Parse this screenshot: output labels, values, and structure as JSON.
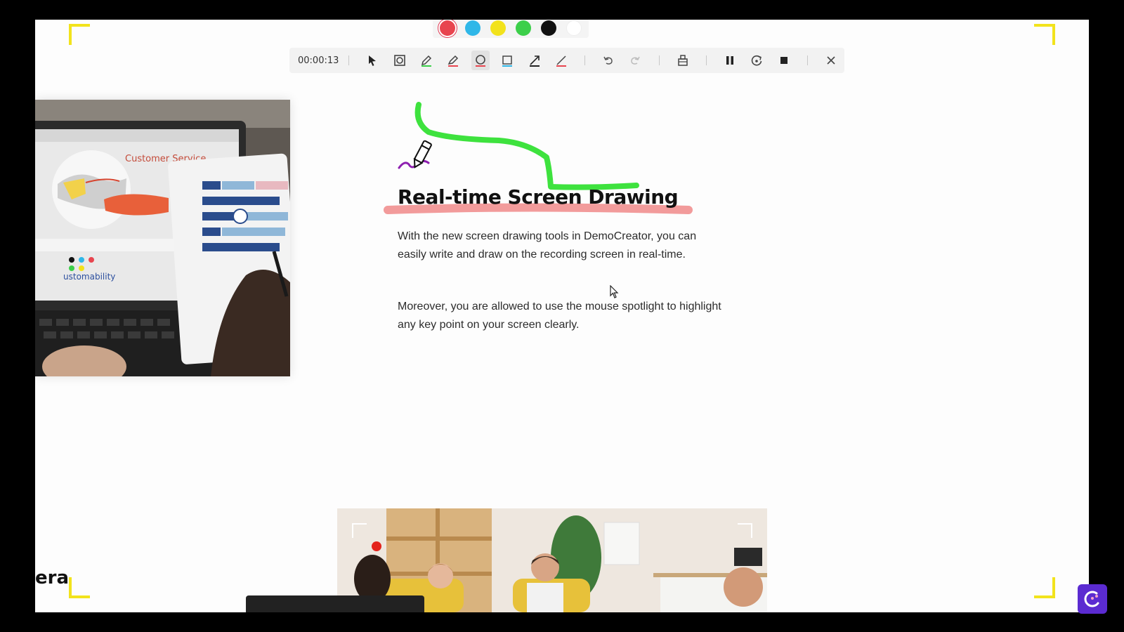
{
  "recorder": {
    "timer": "00:00:13",
    "palette": [
      {
        "name": "red",
        "color": "#e8454f",
        "selected": true
      },
      {
        "name": "blue",
        "color": "#2fb7e8",
        "selected": false
      },
      {
        "name": "yellow",
        "color": "#f2e21c",
        "selected": false
      },
      {
        "name": "green",
        "color": "#3ccf4a",
        "selected": false
      },
      {
        "name": "black",
        "color": "#111111",
        "selected": false
      },
      {
        "name": "white",
        "color": "#ffffff",
        "selected": false
      }
    ],
    "tools": [
      {
        "name": "pointer",
        "icon": "cursor-icon"
      },
      {
        "name": "spotlight",
        "icon": "spotlight-icon"
      },
      {
        "name": "pen-green",
        "icon": "pen-icon"
      },
      {
        "name": "highlighter",
        "icon": "highlighter-icon"
      },
      {
        "name": "circle",
        "icon": "circle-icon",
        "active": true
      },
      {
        "name": "rectangle",
        "icon": "rectangle-icon"
      },
      {
        "name": "arrow",
        "icon": "arrow-icon"
      },
      {
        "name": "line",
        "icon": "line-icon"
      },
      {
        "name": "undo",
        "icon": "undo-icon"
      },
      {
        "name": "redo",
        "icon": "redo-icon"
      },
      {
        "name": "eraser",
        "icon": "eraser-icon"
      },
      {
        "name": "pause",
        "icon": "pause-icon"
      },
      {
        "name": "restart",
        "icon": "restart-icon"
      },
      {
        "name": "stop",
        "icon": "stop-icon"
      },
      {
        "name": "close",
        "icon": "close-icon"
      }
    ],
    "accent_frame_color": "#f2e31c"
  },
  "content": {
    "headline": "Real-time Screen Drawing",
    "para1": "With the new screen drawing tools in DemoCreator, you can easily write and draw on the recording screen in real-time.",
    "para2": "Moreover, you are allowed to use the mouse spotlight to highlight any key point on your screen clearly.",
    "laptop_image_caption": "Customer Service",
    "laptop_image_text": "ustomability",
    "logo_partial": "era"
  }
}
